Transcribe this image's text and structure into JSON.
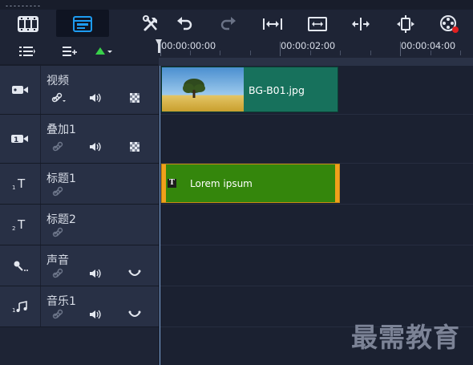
{
  "toolbar": {
    "buttons": [
      {
        "name": "storyboard-view-icon"
      },
      {
        "name": "timeline-view-icon",
        "active": true
      },
      {
        "name": "tools-icon"
      },
      {
        "name": "undo-icon"
      },
      {
        "name": "redo-icon"
      },
      {
        "name": "fit-project-icon"
      },
      {
        "name": "fit-window-icon"
      },
      {
        "name": "split-icon"
      },
      {
        "name": "trim-icon"
      },
      {
        "name": "record-capture-icon"
      }
    ]
  },
  "subbar": {
    "buttons": [
      "track-manager-icon",
      "add-track-icon",
      "track-options-icon"
    ]
  },
  "ruler": {
    "labels": [
      "00:00:00:00",
      "00:00:02:00",
      "00:00:04:00"
    ]
  },
  "tracks": [
    {
      "name": "视频",
      "icon": "video-track-icon",
      "controls": [
        "link-icon",
        "audio-icon",
        "checkerboard-icon"
      ]
    },
    {
      "name": "叠加1",
      "icon": "overlay-track-icon",
      "badge": "1",
      "controls": [
        "link-icon",
        "audio-icon",
        "checkerboard-icon"
      ]
    },
    {
      "name": "标题1",
      "icon": "title-track-icon",
      "badge": "1",
      "controls": [
        "link-icon"
      ]
    },
    {
      "name": "标题2",
      "icon": "title-track-icon",
      "badge": "2",
      "controls": [
        "link-icon"
      ]
    },
    {
      "name": "声音",
      "icon": "voice-track-icon",
      "controls": [
        "link-icon",
        "audio-icon",
        "waveform-icon"
      ]
    },
    {
      "name": "音乐1",
      "icon": "music-track-icon",
      "badge": "1",
      "controls": [
        "link-icon",
        "audio-icon",
        "waveform-icon"
      ]
    }
  ],
  "clips": {
    "video": {
      "label": "BG-B01.jpg"
    },
    "title": {
      "label": "Lorem ipsum",
      "badge": "T"
    }
  },
  "colors": {
    "accent": "#1d9bf0",
    "video_clip": "#17715c",
    "title_clip": "#34860c",
    "title_clip_edge": "#f0a01b",
    "record": "#e02020"
  },
  "watermark": "最需教育"
}
